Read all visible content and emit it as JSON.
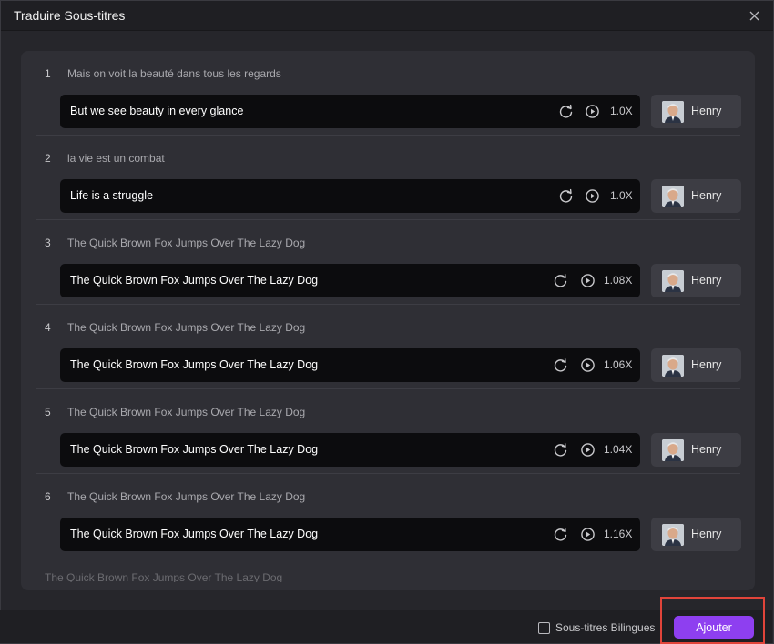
{
  "dialog": {
    "title": "Traduire Sous-titres"
  },
  "rows": [
    {
      "num": "1",
      "source": "Mais on voit la beauté dans tous les regards",
      "translation": "But we see beauty in every glance",
      "speed": "1.0X",
      "speaker": "Henry"
    },
    {
      "num": "2",
      "source": "la vie est un combat",
      "translation": "Life is a struggle",
      "speed": "1.0X",
      "speaker": "Henry"
    },
    {
      "num": "3",
      "source": "The Quick Brown Fox Jumps Over The Lazy Dog",
      "translation": "The Quick Brown Fox Jumps Over The Lazy Dog",
      "speed": "1.08X",
      "speaker": "Henry"
    },
    {
      "num": "4",
      "source": "The Quick Brown Fox Jumps Over The Lazy Dog",
      "translation": "The Quick Brown Fox Jumps Over The Lazy Dog",
      "speed": "1.06X",
      "speaker": "Henry"
    },
    {
      "num": "5",
      "source": "The Quick Brown Fox Jumps Over The Lazy Dog",
      "translation": "The Quick Brown Fox Jumps Over The Lazy Dog",
      "speed": "1.04X",
      "speaker": "Henry"
    },
    {
      "num": "6",
      "source": "The Quick Brown Fox Jumps Over The Lazy Dog",
      "translation": "The Quick Brown Fox Jumps Over The Lazy Dog",
      "speed": "1.16X",
      "speaker": "Henry"
    }
  ],
  "partial_row": {
    "text": "The Quick Brown Fox Jumps Over The Lazy Dog"
  },
  "footer": {
    "bilingual_label": "Sous-titres Bilingues",
    "bilingual_checked": false,
    "add_label": "Ajouter"
  },
  "icons": {
    "close": "close-icon",
    "regenerate": "refresh-icon",
    "play": "play-icon"
  },
  "colors": {
    "accent": "#8e3ff0",
    "highlight": "#e0443a"
  }
}
